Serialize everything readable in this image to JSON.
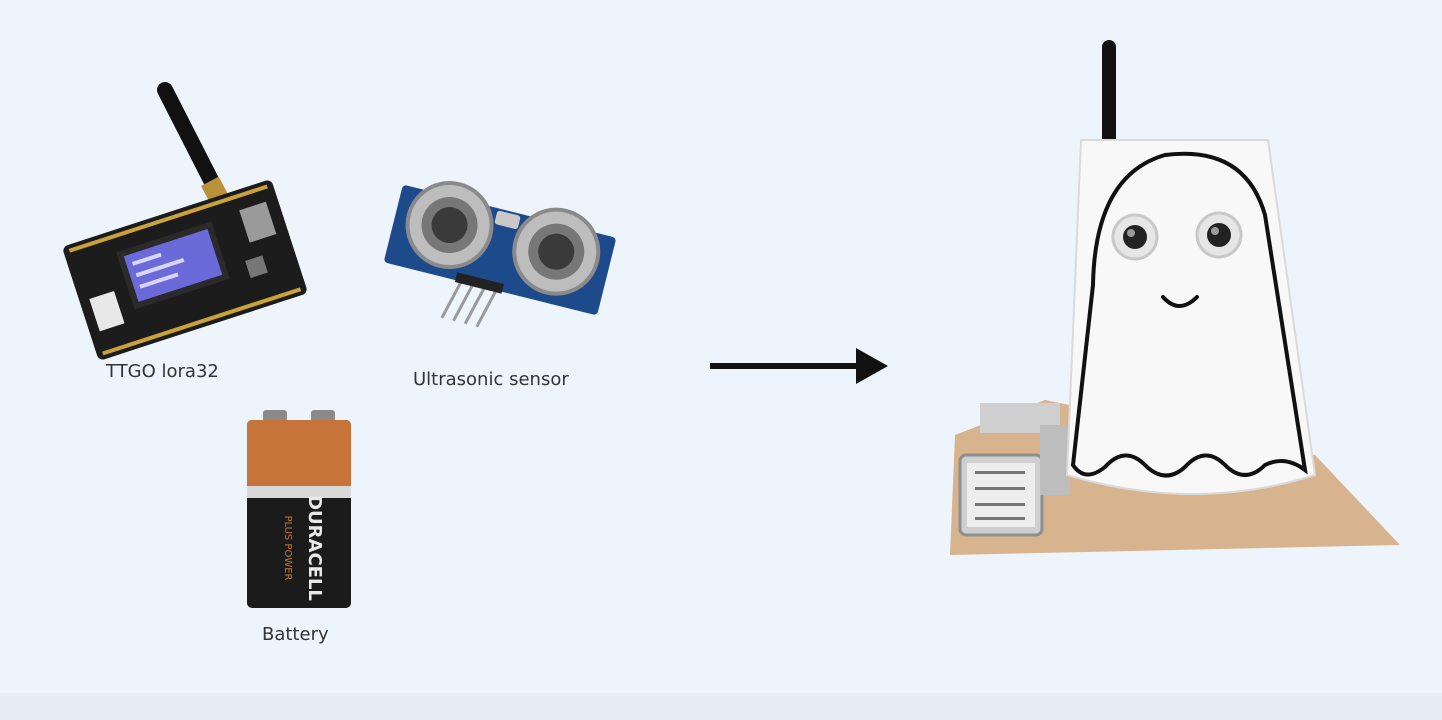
{
  "components": {
    "board": {
      "label": "TTGO lora32",
      "icon": "ttgo-lora32-board"
    },
    "sensor": {
      "label": "Ultrasonic sensor",
      "icon": "ultrasonic-sensor"
    },
    "battery": {
      "label": "Battery",
      "icon": "9v-battery",
      "brand": "DURACELL",
      "subbrand": "PLUS POWER"
    }
  },
  "result": {
    "icon": "ghost-device"
  },
  "colors": {
    "background": "#eef4fb",
    "arrow": "#111111",
    "pcb_black": "#1c1c1c",
    "pcb_blue": "#1d4a8a",
    "battery_copper": "#c7743a",
    "cardboard": "#d7b48e"
  }
}
